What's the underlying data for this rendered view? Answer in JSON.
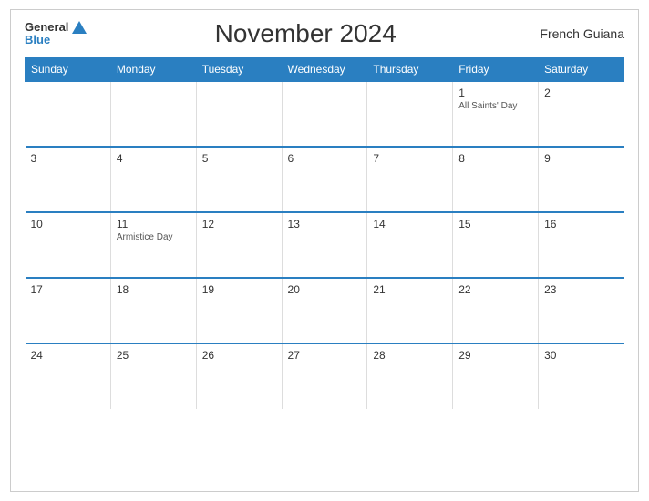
{
  "header": {
    "title": "November 2024",
    "region": "French Guiana",
    "logo_general": "General",
    "logo_blue": "Blue"
  },
  "weekdays": [
    "Sunday",
    "Monday",
    "Tuesday",
    "Wednesday",
    "Thursday",
    "Friday",
    "Saturday"
  ],
  "weeks": [
    [
      {
        "day": "",
        "event": ""
      },
      {
        "day": "",
        "event": ""
      },
      {
        "day": "",
        "event": ""
      },
      {
        "day": "",
        "event": ""
      },
      {
        "day": "",
        "event": ""
      },
      {
        "day": "1",
        "event": "All Saints' Day"
      },
      {
        "day": "2",
        "event": ""
      }
    ],
    [
      {
        "day": "3",
        "event": ""
      },
      {
        "day": "4",
        "event": ""
      },
      {
        "day": "5",
        "event": ""
      },
      {
        "day": "6",
        "event": ""
      },
      {
        "day": "7",
        "event": ""
      },
      {
        "day": "8",
        "event": ""
      },
      {
        "day": "9",
        "event": ""
      }
    ],
    [
      {
        "day": "10",
        "event": ""
      },
      {
        "day": "11",
        "event": "Armistice Day"
      },
      {
        "day": "12",
        "event": ""
      },
      {
        "day": "13",
        "event": ""
      },
      {
        "day": "14",
        "event": ""
      },
      {
        "day": "15",
        "event": ""
      },
      {
        "day": "16",
        "event": ""
      }
    ],
    [
      {
        "day": "17",
        "event": ""
      },
      {
        "day": "18",
        "event": ""
      },
      {
        "day": "19",
        "event": ""
      },
      {
        "day": "20",
        "event": ""
      },
      {
        "day": "21",
        "event": ""
      },
      {
        "day": "22",
        "event": ""
      },
      {
        "day": "23",
        "event": ""
      }
    ],
    [
      {
        "day": "24",
        "event": ""
      },
      {
        "day": "25",
        "event": ""
      },
      {
        "day": "26",
        "event": ""
      },
      {
        "day": "27",
        "event": ""
      },
      {
        "day": "28",
        "event": ""
      },
      {
        "day": "29",
        "event": ""
      },
      {
        "day": "30",
        "event": ""
      }
    ]
  ]
}
